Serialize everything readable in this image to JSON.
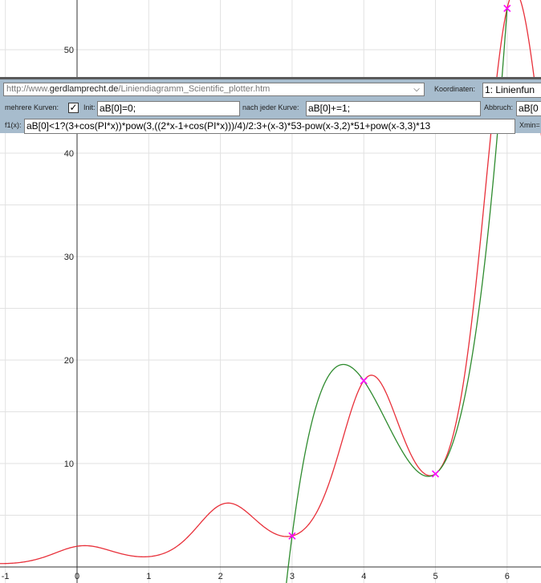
{
  "toolbar": {
    "url_prefix": "http://www.",
    "url_host": "gerdlamprecht.de",
    "url_path": "/Liniendiagramm_Scientific_plotter.htm",
    "koordinaten_label": "Koordinaten:",
    "koordinaten_value": "1: Linienfun",
    "mehrere_label": "mehrere Kurven:",
    "mehrere_checked": "✓",
    "init_label": "Init:",
    "init_value": "aB[0]=0;",
    "nach_label": "nach jeder Kurve:",
    "nach_value": "aB[0]+=1;",
    "abbruch_label": "Abbruch:",
    "abbruch_value": "aB[0",
    "f1_label": "f1(x):",
    "f1_value": "aB[0]<1?(3+cos(PI*x))*pow(3,((2*x-1+cos(PI*x)))/4)/2:3+(x-3)*53-pow(x-3,2)*51+pow(x-3,3)*13",
    "xmin_label": "Xmin="
  },
  "chart_data": {
    "type": "line",
    "xlim": [
      -1.08,
      6.5
    ],
    "ylim": [
      -2.2,
      57
    ],
    "grid": true,
    "x_ticks": [
      -1,
      0,
      1,
      2,
      3,
      4,
      5,
      6
    ],
    "y_ticks": [
      10,
      20,
      30,
      40,
      50
    ],
    "series": [
      {
        "color": "#e8303a",
        "formula": "(3+cos(PI*x))*pow(3,((2*x-1+cos(PI*x)))/4)/2",
        "x_range": [
          -1.08,
          6.5
        ]
      },
      {
        "color": "#2e8b2e",
        "formula": "3+(x-3)*53-pow(x-3,2)*51+pow(x-3,3)*13",
        "x_range": [
          2.9,
          6.0
        ]
      }
    ],
    "markers": {
      "color": "#ff00ff",
      "symbol": "x",
      "points": [
        {
          "x": 3,
          "y": 3
        },
        {
          "x": 4,
          "y": 18
        },
        {
          "x": 5,
          "y": 9
        },
        {
          "x": 6,
          "y": 54
        }
      ]
    }
  }
}
